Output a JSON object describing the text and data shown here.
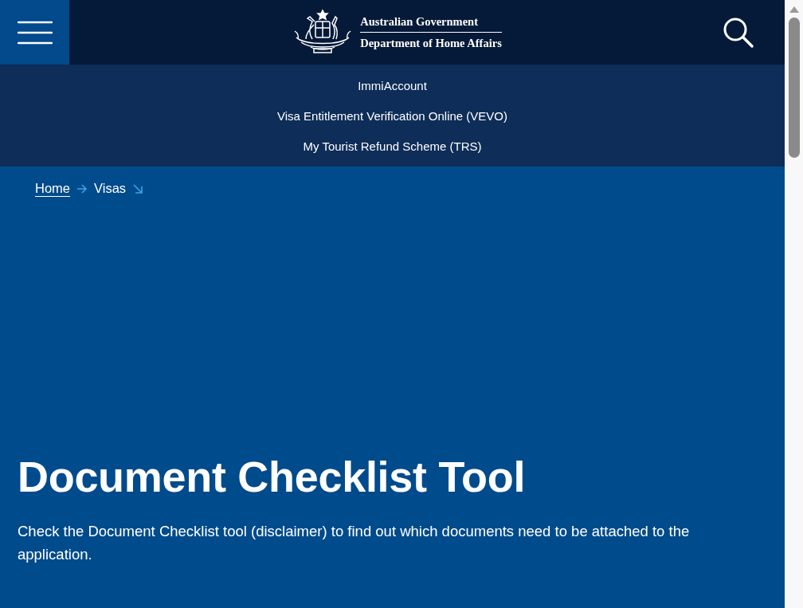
{
  "header": {
    "logo_line_1": "Australian Government",
    "logo_line_2": "Department of Home Affairs"
  },
  "quick_links": [
    "ImmiAccount",
    "Visa Entitlement Verification Online (VEVO)",
    "My Tourist Refund Scheme (TRS)"
  ],
  "breadcrumb": [
    {
      "label": "Home",
      "kind": "link"
    },
    {
      "label": "Visas",
      "kind": "current"
    }
  ],
  "hero": {
    "title": "Document Checklist Tool",
    "description": "Check the Document Checklist tool (disclaimer) to find out which documents need to be attached to the application."
  }
}
